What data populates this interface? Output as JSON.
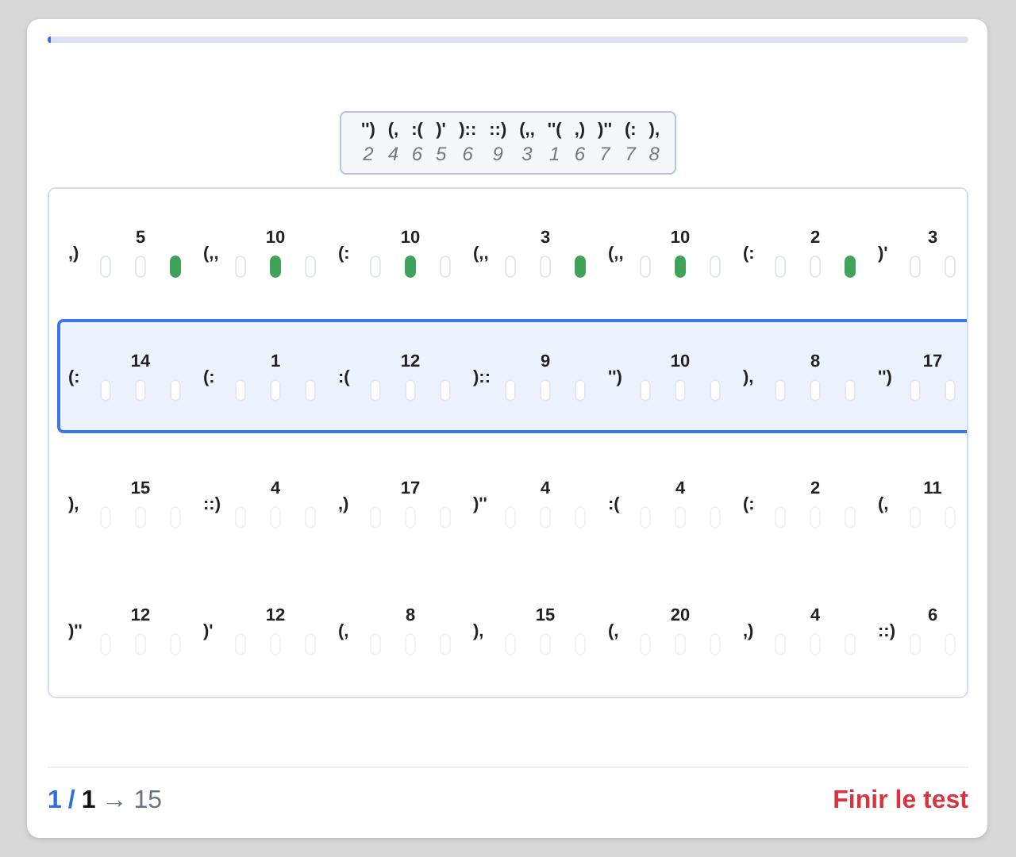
{
  "progress": {
    "level": 0.003
  },
  "legend": [
    {
      "symbol": "'')",
      "number": "2"
    },
    {
      "symbol": "(,",
      "number": "4"
    },
    {
      "symbol": ":(",
      "number": "6"
    },
    {
      "symbol": ")'",
      "number": "5"
    },
    {
      "symbol": ")::",
      "number": "6"
    },
    {
      "symbol": "::)",
      "number": "9"
    },
    {
      "symbol": "(,,",
      "number": "3"
    },
    {
      "symbol": "''(",
      "number": "1"
    },
    {
      "symbol": ",)",
      "number": "6"
    },
    {
      "symbol": ")''",
      "number": "7"
    },
    {
      "symbol": "(:",
      "number": "7"
    },
    {
      "symbol": "),",
      "number": "8"
    }
  ],
  "rows": [
    {
      "selected": false,
      "dimmed": false,
      "groups": [
        {
          "symbol": ",)",
          "number": "5",
          "slots": [
            false,
            false,
            true
          ]
        },
        {
          "symbol": "(,,",
          "number": "10",
          "slots": [
            false,
            true,
            false
          ]
        },
        {
          "symbol": "(:",
          "number": "10",
          "slots": [
            false,
            true,
            false
          ]
        },
        {
          "symbol": "(,,",
          "number": "3",
          "slots": [
            false,
            false,
            true
          ]
        },
        {
          "symbol": "(,,",
          "number": "10",
          "slots": [
            false,
            true,
            false
          ]
        },
        {
          "symbol": "(:",
          "number": "2",
          "slots": [
            false,
            false,
            true
          ]
        },
        {
          "symbol": ")'",
          "number": "3",
          "slots": [
            false,
            false
          ]
        }
      ]
    },
    {
      "selected": true,
      "dimmed": false,
      "groups": [
        {
          "symbol": "(:",
          "number": "14",
          "slots": [
            false,
            false,
            false
          ]
        },
        {
          "symbol": "(:",
          "number": "1",
          "slots": [
            false,
            false,
            false
          ]
        },
        {
          "symbol": ":(",
          "number": "12",
          "slots": [
            false,
            false,
            false
          ]
        },
        {
          "symbol": ")::",
          "number": "9",
          "slots": [
            false,
            false,
            false
          ]
        },
        {
          "symbol": "'')",
          "number": "10",
          "slots": [
            false,
            false,
            false
          ]
        },
        {
          "symbol": "),",
          "number": "8",
          "slots": [
            false,
            false,
            false
          ]
        },
        {
          "symbol": "'')",
          "number": "17",
          "slots": [
            false,
            false
          ]
        }
      ]
    },
    {
      "selected": false,
      "dimmed": true,
      "groups": [
        {
          "symbol": "),",
          "number": "15",
          "slots": [
            false,
            false,
            false
          ]
        },
        {
          "symbol": "::)",
          "number": "4",
          "slots": [
            false,
            false,
            false
          ]
        },
        {
          "symbol": ",)",
          "number": "17",
          "slots": [
            false,
            false,
            false
          ]
        },
        {
          "symbol": ")''",
          "number": "4",
          "slots": [
            false,
            false,
            false
          ]
        },
        {
          "symbol": ":(",
          "number": "4",
          "slots": [
            false,
            false,
            false
          ]
        },
        {
          "symbol": "(:",
          "number": "2",
          "slots": [
            false,
            false,
            false
          ]
        },
        {
          "symbol": "(,",
          "number": "11",
          "slots": [
            false,
            false
          ]
        }
      ]
    },
    {
      "selected": false,
      "dimmed": true,
      "groups": [
        {
          "symbol": ")''",
          "number": "12",
          "slots": [
            false,
            false,
            false
          ]
        },
        {
          "symbol": ")'",
          "number": "12",
          "slots": [
            false,
            false,
            false
          ]
        },
        {
          "symbol": "(,",
          "number": "8",
          "slots": [
            false,
            false,
            false
          ]
        },
        {
          "symbol": "),",
          "number": "15",
          "slots": [
            false,
            false,
            false
          ]
        },
        {
          "symbol": "(,",
          "number": "20",
          "slots": [
            false,
            false,
            false
          ]
        },
        {
          "symbol": ",)",
          "number": "4",
          "slots": [
            false,
            false,
            false
          ]
        },
        {
          "symbol": "::)",
          "number": "6",
          "slots": [
            false,
            false
          ]
        }
      ]
    }
  ],
  "footer": {
    "current": "1",
    "separator": "/",
    "total": "1",
    "arrow": "→",
    "next": "15",
    "finish_button": "Finir le test"
  }
}
